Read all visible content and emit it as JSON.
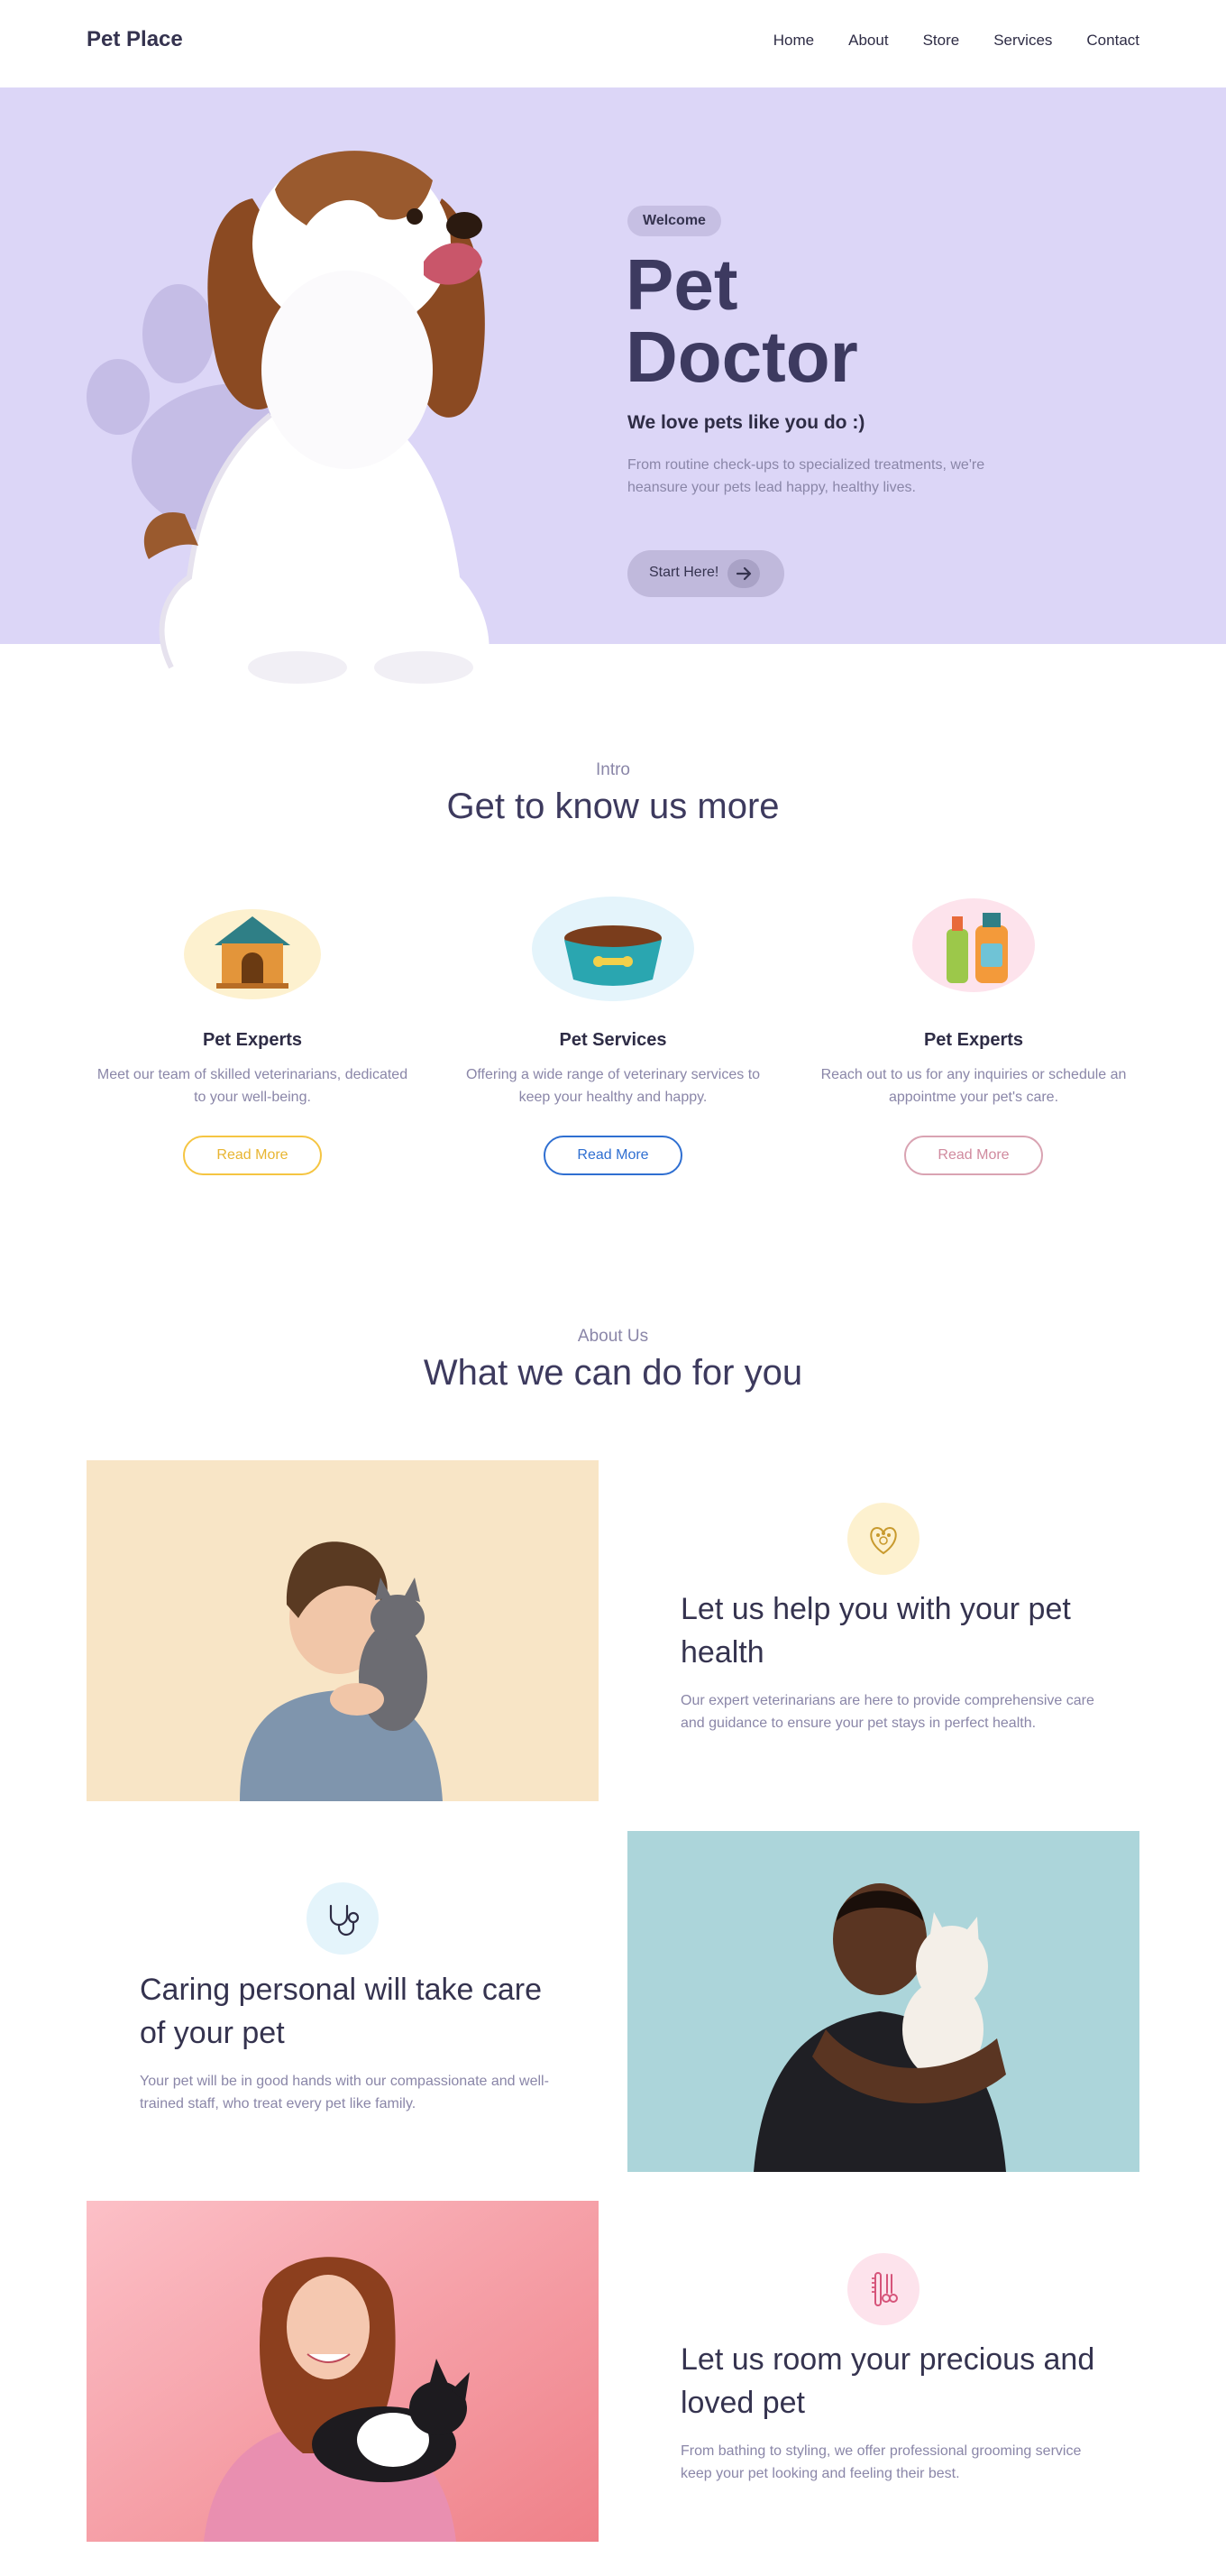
{
  "nav": {
    "logo": "Pet Place",
    "links": [
      "Home",
      "About",
      "Store",
      "Services",
      "Contact"
    ]
  },
  "hero": {
    "badge": "Welcome",
    "title_line1": "Pet",
    "title_line2": "Doctor",
    "subtitle": "We love pets like you do :)",
    "description": "From routine check-ups to specialized treatments, we're heansure your pets lead happy, healthy lives.",
    "button_label": "Start Here!"
  },
  "intro": {
    "eyebrow": "Intro",
    "title": "Get to know us more",
    "cards": [
      {
        "title": "Pet Experts",
        "text": "Meet our team of skilled veterinarians, dedicated to your well-being.",
        "button": "Read More",
        "accent": "#f5c542"
      },
      {
        "title": "Pet Services",
        "text": "Offering a wide range of veterinary services to keep your healthy and happy.",
        "button": "Read More",
        "accent": "#2f6fd1"
      },
      {
        "title": "Pet Experts",
        "text": "Reach out to us for any inquiries or schedule an appointme your pet's care.",
        "button": "Read More",
        "accent": "#d9a3b2"
      }
    ]
  },
  "about": {
    "eyebrow": "About Us",
    "title": "What we can do for you",
    "features": [
      {
        "title": "Let us help you with your pet health",
        "text": "Our expert veterinarians are here to provide comprehensive care and guidance to ensure your pet stays in perfect health.",
        "icon": "heart-paw-icon"
      },
      {
        "title": "Caring personal will take care of your pet",
        "text": "Your pet will be in good hands with our compassionate and well-trained staff, who treat every pet like family.",
        "icon": "stethoscope-icon"
      },
      {
        "title": "Let us room your precious and loved pet",
        "text": "From bathing to styling, we offer professional grooming service keep your pet looking and feeling their best.",
        "icon": "grooming-icon"
      }
    ]
  },
  "colors": {
    "hero_bg": "#dcd6f7",
    "heading": "#3d3a5e",
    "muted": "#8a86a8"
  }
}
